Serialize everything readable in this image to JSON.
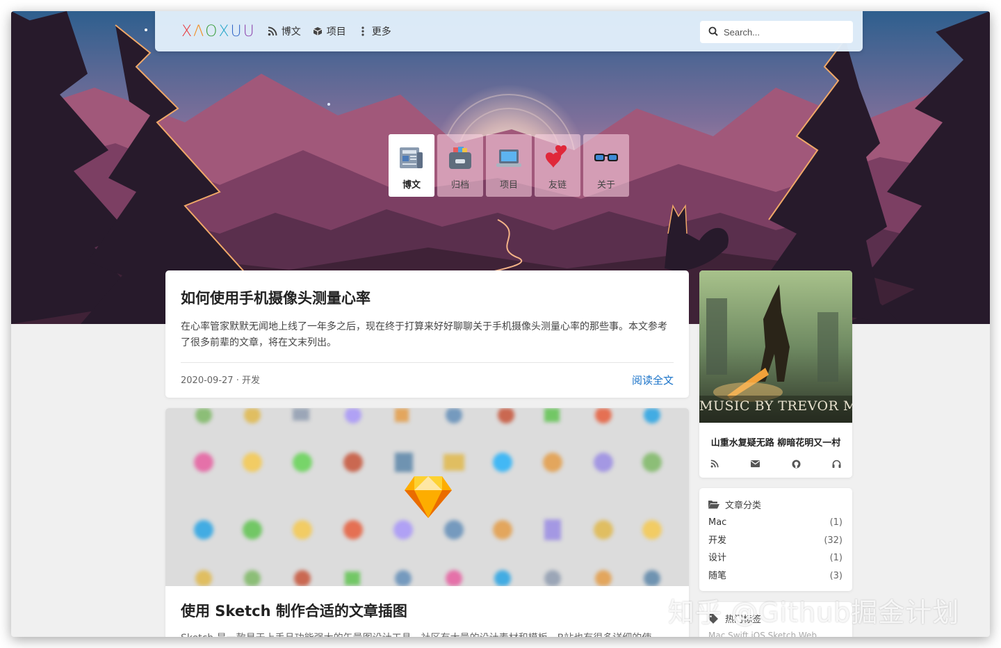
{
  "nav": {
    "logo_letters": [
      "X",
      "Λ",
      "O",
      "X",
      "U",
      "U"
    ],
    "logo_colors": [
      "#e8383d",
      "#f28c1c",
      "#3b9f3e",
      "#27a6c9",
      "#3468c8",
      "#8e44ad"
    ],
    "items": [
      {
        "icon": "rss-icon",
        "label": "博文"
      },
      {
        "icon": "cube-icon",
        "label": "项目"
      },
      {
        "icon": "more-vertical-icon",
        "label": "更多"
      }
    ],
    "search_placeholder": "Search..."
  },
  "tiles": [
    {
      "icon": "newspaper-icon",
      "label": "博文",
      "active": true
    },
    {
      "icon": "archive-box-icon",
      "label": "归档",
      "active": false
    },
    {
      "icon": "laptop-icon",
      "label": "项目",
      "active": false
    },
    {
      "icon": "two-hearts-icon",
      "label": "友链",
      "active": false
    },
    {
      "icon": "glasses-icon",
      "label": "关于",
      "active": false
    }
  ],
  "post1": {
    "title": "如何使用手机摄像头测量心率",
    "excerpt": "在心率管家默默无闻地上线了一年多之后，现在终于打算来好好聊聊关于手机摄像头测量心率的那些事。本文参考了很多前辈的文章，将在文末列出。",
    "date": "2020-09-27",
    "separator": " · ",
    "category": "开发",
    "read_more": "阅读全文"
  },
  "post2": {
    "cover_icon": "sketch-diamond-icon",
    "title": "使用 Sketch 制作合适的文章插图",
    "excerpt": "Sketch 是一款易于上手且功能强大的矢量图设计工具，社区有大量的设计素材和模板，B站也有很多详细的使"
  },
  "profile": {
    "album_text": "MUSIC BY TREVOR MORR",
    "motto": "山重水复疑无路 柳暗花明又一村",
    "social": [
      "rss-icon",
      "mail-icon",
      "github-icon",
      "headphones-icon"
    ]
  },
  "categories": {
    "icon": "folder-open-icon",
    "title": "文章分类",
    "items": [
      {
        "name": "Mac",
        "count": "(1)"
      },
      {
        "name": "开发",
        "count": "(32)"
      },
      {
        "name": "设计",
        "count": "(1)"
      },
      {
        "name": "随笔",
        "count": "(3)"
      }
    ]
  },
  "tags": {
    "icon": "tags-icon",
    "title": "热门标签",
    "line": "Mac  Swift  iOS  Sketch  Web"
  },
  "watermark": "知乎 @Github掘金计划"
}
